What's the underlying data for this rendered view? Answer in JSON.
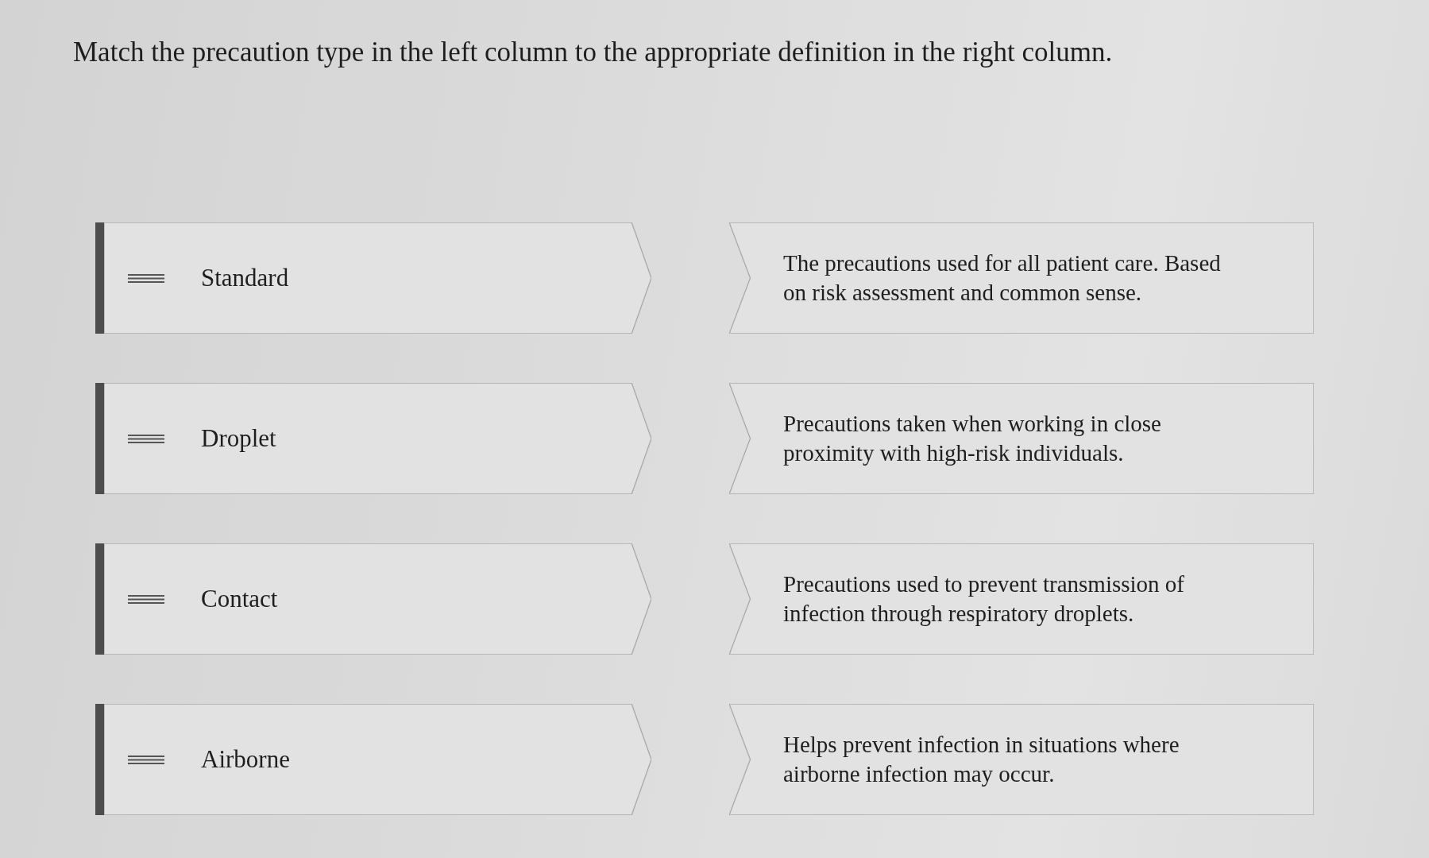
{
  "instruction": "Match the precaution type in the left column to the appropriate definition in the right column.",
  "terms": [
    {
      "label": "Standard"
    },
    {
      "label": "Droplet"
    },
    {
      "label": "Contact"
    },
    {
      "label": "Airborne"
    }
  ],
  "definitions": [
    {
      "text": "The precautions used for all patient care. Based\non risk assessment and common sense."
    },
    {
      "text": "Precautions taken when working in close\nproximity with high-risk individuals."
    },
    {
      "text": "Precautions used to prevent transmission of\ninfection through respiratory droplets."
    },
    {
      "text": "Helps prevent infection in situations where\nairborne infection may occur."
    }
  ]
}
